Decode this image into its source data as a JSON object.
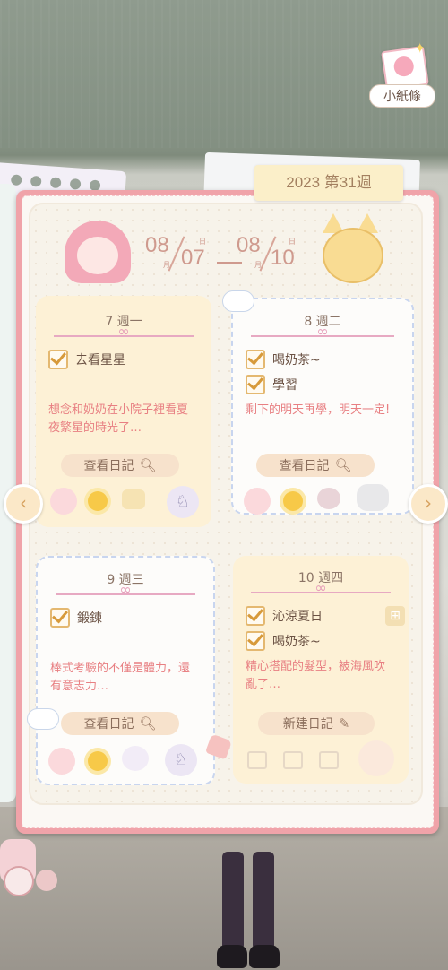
{
  "note_button": {
    "label": "小紙條"
  },
  "header": {
    "week_label": "2023 第31週"
  },
  "date_range": {
    "start_month": "08",
    "start_day": "07",
    "end_month": "08",
    "end_day": "10",
    "month_unit": "月",
    "day_unit": "日"
  },
  "days": [
    {
      "title": "7  週一",
      "tasks": [
        "去看星星"
      ],
      "text": "想念和奶奶在小院子裡看夏夜繁星的時光了…",
      "button": "查看日記",
      "stickers": [
        "smile-sticker",
        "sun-sticker",
        "sticker-item",
        "bunny-sticker"
      ]
    },
    {
      "title": "8  週二",
      "tasks": [
        "喝奶茶~",
        "學習"
      ],
      "text": "剩下的明天再學，明天一定!",
      "button": "查看日記",
      "stickers": [
        "smile-sticker",
        "sun-sticker",
        "sticker-item",
        "sticker-item"
      ]
    },
    {
      "title": "9  週三",
      "tasks": [
        "鍛鍊"
      ],
      "text": "棒式考驗的不僅是體力，還有意志力…",
      "button": "查看日記",
      "stickers": [
        "smile-sticker",
        "sun-sticker",
        "unicorn-sticker",
        "bunny-sticker"
      ]
    },
    {
      "title": "10  週四",
      "tasks": [
        "沁涼夏日",
        "喝奶茶~"
      ],
      "text": "精心搭配的髮型，被海風吹亂了…",
      "button": "新建日記",
      "stickers": []
    }
  ],
  "icons": {
    "search": "search-icon",
    "edit": "edit-icon",
    "prev": "chevron-left-icon",
    "next": "chevron-right-icon",
    "gift": "gift-icon"
  }
}
